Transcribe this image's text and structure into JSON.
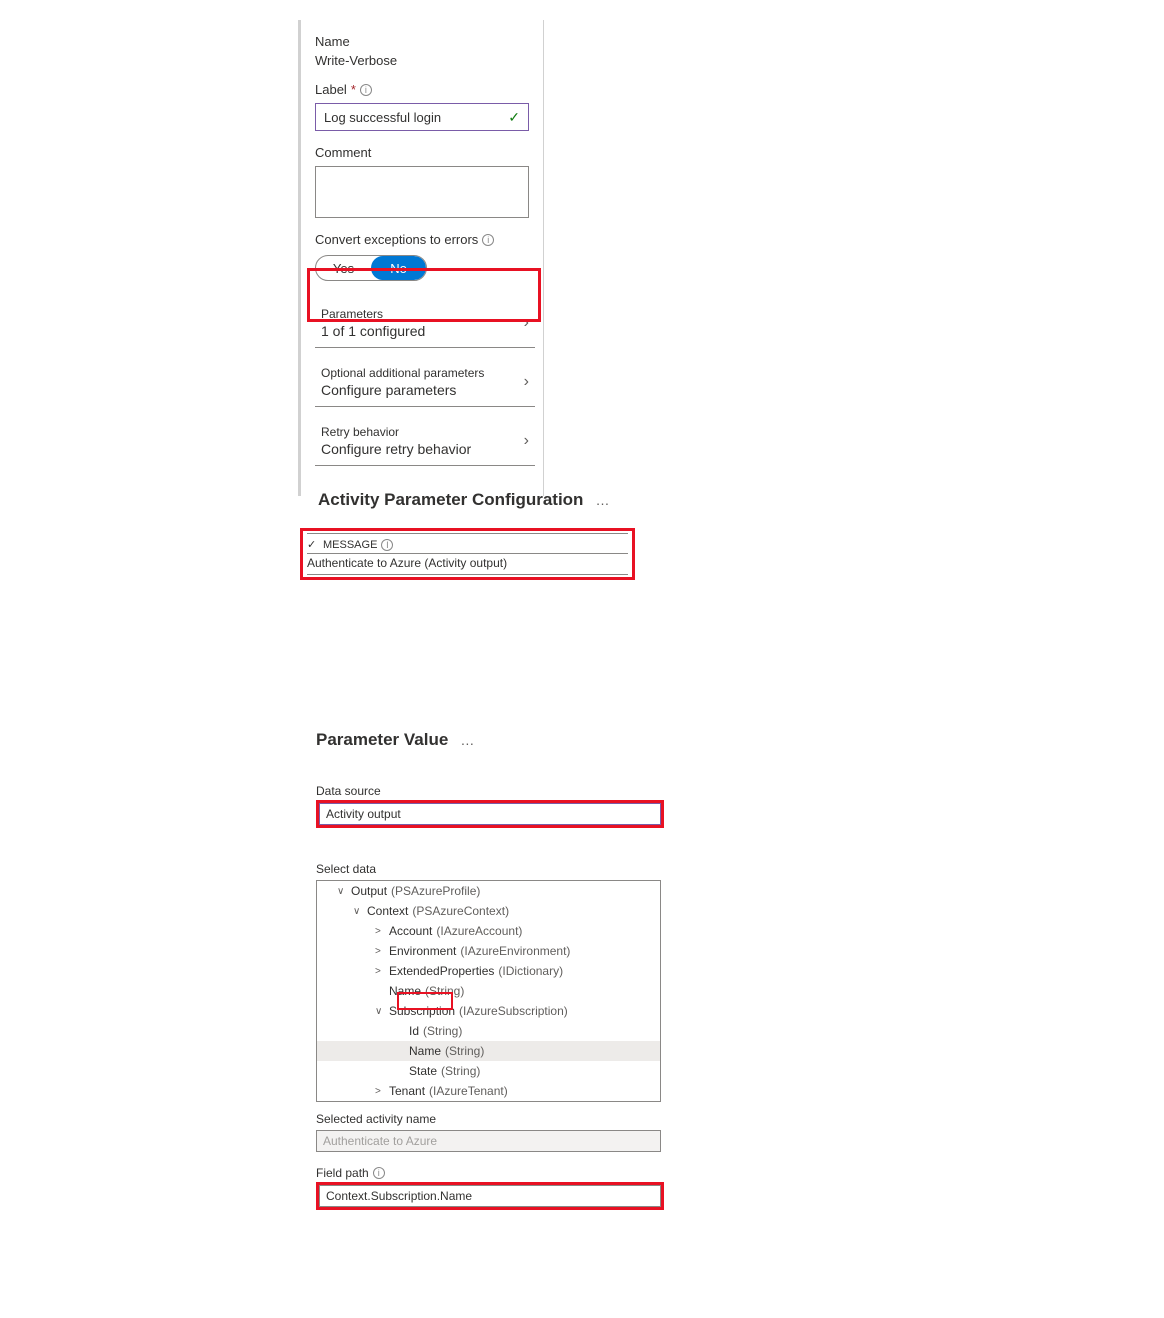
{
  "panel1": {
    "name_label": "Name",
    "name_value": "Write-Verbose",
    "label_label": "Label",
    "label_value": "Log successful login",
    "comment_label": "Comment",
    "convert_label": "Convert exceptions to errors",
    "yes": "Yes",
    "no": "No",
    "rows": [
      {
        "title": "Parameters",
        "sub": "1 of 1 configured"
      },
      {
        "title": "Optional additional parameters",
        "sub": "Configure parameters"
      },
      {
        "title": "Retry behavior",
        "sub": "Configure retry behavior"
      }
    ]
  },
  "section2": {
    "heading": "Activity Parameter Configuration",
    "msg_label": "MESSAGE",
    "msg_value": "Authenticate to Azure (Activity output)"
  },
  "section3": {
    "heading": "Parameter Value",
    "data_source_label": "Data source",
    "data_source_value": "Activity output",
    "select_data_label": "Select data",
    "tree": [
      {
        "indent": 0,
        "caret": "v",
        "name": "Output",
        "type": "(PSAzureProfile)"
      },
      {
        "indent": 1,
        "caret": "v",
        "name": "Context",
        "type": "(PSAzureContext)"
      },
      {
        "indent": 2,
        "caret": ">",
        "name": "Account",
        "type": "(IAzureAccount)"
      },
      {
        "indent": 2,
        "caret": ">",
        "name": "Environment",
        "type": "(IAzureEnvironment)"
      },
      {
        "indent": 2,
        "caret": ">",
        "name": "ExtendedProperties",
        "type": "(IDictionary)"
      },
      {
        "indent": 2,
        "caret": "",
        "name": "Name",
        "type": "(String)"
      },
      {
        "indent": 2,
        "caret": "v",
        "name": "Subscription",
        "type": "(IAzureSubscription)"
      },
      {
        "indent": 3,
        "caret": "",
        "name": "Id",
        "type": "(String)"
      },
      {
        "indent": 3,
        "caret": "",
        "name": "Name",
        "type": "(String)",
        "selected": true
      },
      {
        "indent": 3,
        "caret": "",
        "name": "State",
        "type": "(String)"
      },
      {
        "indent": 2,
        "caret": ">",
        "name": "Tenant",
        "type": "(IAzureTenant)"
      }
    ],
    "selected_activity_label": "Selected activity name",
    "selected_activity_value": "Authenticate to Azure",
    "field_path_label": "Field path",
    "field_path_value": "Context.Subscription.Name"
  }
}
